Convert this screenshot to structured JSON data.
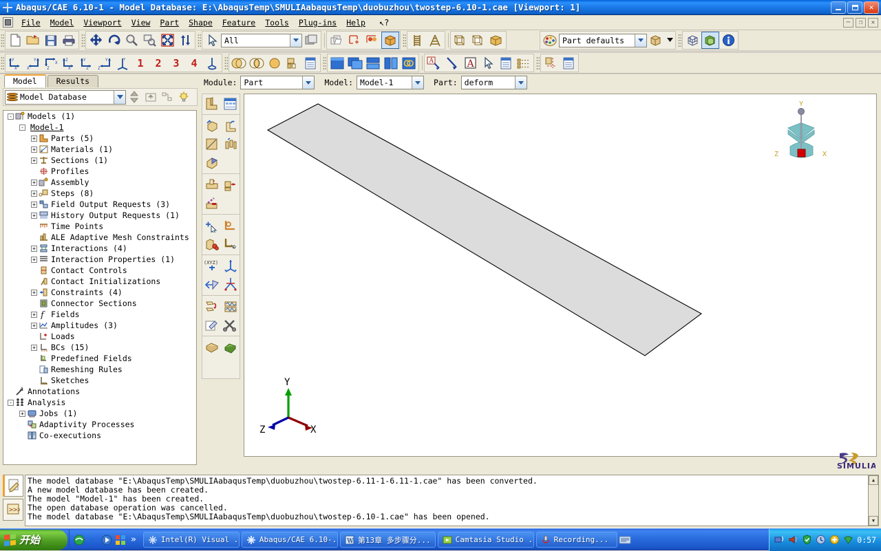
{
  "window": {
    "title": "Abaqus/CAE 6.10-1 - Model Database: E:\\AbaqusTemp\\SMULIAabaqusTemp\\duobuzhou\\twostep-6.10-1.cae [Viewport: 1]",
    "minimize": "_",
    "maximize": "❑",
    "close": "✕"
  },
  "menu": {
    "items": [
      {
        "label": "File"
      },
      {
        "label": "Model"
      },
      {
        "label": "Viewport"
      },
      {
        "label": "View"
      },
      {
        "label": "Part"
      },
      {
        "label": "Shape"
      },
      {
        "label": "Feature"
      },
      {
        "label": "Tools"
      },
      {
        "label": "Plug-ins"
      },
      {
        "label": "Help"
      }
    ],
    "help_arrow": "↖?",
    "win_restore": "─",
    "win_max": "❐",
    "win_close": "✕"
  },
  "toolbar1": {
    "selection_filter_value": "All",
    "render_style_value": "Part defaults",
    "buttons": [
      "new-file-icon",
      "open-file-icon",
      "save-icon",
      "print-icon",
      "pan-icon",
      "rotate-icon",
      "magnify-icon",
      "box-zoom-icon",
      "auto-fit-icon",
      "zoom-in-out-icon",
      "select-arrow-icon",
      "selection-filter-combo",
      "viewport-icon",
      "overlay-icon",
      "create-set-icon",
      "create-surface-icon",
      "display-group-icon",
      "mesh-seed-icon",
      "mesh-control-icon",
      "wireframe-icon",
      "hidden-line-icon",
      "shaded-icon",
      "color-palette-icon",
      "render-style-combo",
      "cube-icon",
      "more-arrow",
      "grid-cube-icon",
      "solid-cube-icon",
      "info-icon"
    ]
  },
  "toolbar2": {
    "view_buttons": [
      "view-yx-icon",
      "view-xy-icon",
      "view-zx-icon",
      "view-xz-icon",
      "view-yz-icon",
      "view-zy-icon",
      "iso-view-icon"
    ],
    "saved_views": [
      "1",
      "2",
      "3",
      "4"
    ],
    "apply_view_icon": "apply-view-icon",
    "more": [
      "union-icon",
      "intersect-icon",
      "circle-icon",
      "front-icon",
      "side-icon",
      "list-icon",
      "viewport-single-icon",
      "viewport-cascade-icon",
      "viewport-tile-horiz-icon",
      "viewport-tile-vert-icon",
      "link-viewport-icon",
      "annotation-text-icon",
      "annotation-arrow-icon",
      "text-tool-icon",
      "select-tool-icon",
      "manager-icon",
      "bullet-list-icon",
      "datum-icon",
      "table-icon"
    ]
  },
  "context": {
    "module_label": "Module:",
    "module_value": "Part",
    "model_label": "Model:",
    "model_value": "Model-1",
    "part_label": "Part:",
    "part_value": "deform"
  },
  "left_panel": {
    "tabs": [
      {
        "label": "Model",
        "active": true
      },
      {
        "label": "Results",
        "active": false
      }
    ],
    "database_combo": "Model Database",
    "toolbar_icons": [
      "sort-updown-icon",
      "parent-folder-icon",
      "filter-tree-icon",
      "tips-bulb-icon"
    ],
    "tree": [
      {
        "label": "Models (1)",
        "indent": 0,
        "expander": "-",
        "icon": "models-icon",
        "underline": false
      },
      {
        "label": "Model-1",
        "indent": 1,
        "expander": "-",
        "icon": "none",
        "underline": true
      },
      {
        "label": "Parts (5)",
        "indent": 2,
        "expander": "+",
        "icon": "parts-icon",
        "underline": false
      },
      {
        "label": "Materials (1)",
        "indent": 2,
        "expander": "+",
        "icon": "materials-icon",
        "underline": false
      },
      {
        "label": "Sections (1)",
        "indent": 2,
        "expander": "+",
        "icon": "sections-icon",
        "underline": false
      },
      {
        "label": "Profiles",
        "indent": 2,
        "expander": "",
        "icon": "profiles-icon",
        "underline": false
      },
      {
        "label": "Assembly",
        "indent": 2,
        "expander": "+",
        "icon": "assembly-icon",
        "underline": false
      },
      {
        "label": "Steps (8)",
        "indent": 2,
        "expander": "+",
        "icon": "steps-icon",
        "underline": false
      },
      {
        "label": "Field Output Requests (3)",
        "indent": 2,
        "expander": "+",
        "icon": "field-output-icon",
        "underline": false
      },
      {
        "label": "History Output Requests (1)",
        "indent": 2,
        "expander": "+",
        "icon": "history-output-icon",
        "underline": false
      },
      {
        "label": "Time Points",
        "indent": 2,
        "expander": "",
        "icon": "time-points-icon",
        "underline": false
      },
      {
        "label": "ALE Adaptive Mesh Constraints",
        "indent": 2,
        "expander": "",
        "icon": "ale-mesh-icon",
        "underline": false
      },
      {
        "label": "Interactions (4)",
        "indent": 2,
        "expander": "+",
        "icon": "interactions-icon",
        "underline": false
      },
      {
        "label": "Interaction Properties (1)",
        "indent": 2,
        "expander": "+",
        "icon": "interaction-prop-icon",
        "underline": false
      },
      {
        "label": "Contact Controls",
        "indent": 2,
        "expander": "",
        "icon": "contact-controls-icon",
        "underline": false
      },
      {
        "label": "Contact Initializations",
        "indent": 2,
        "expander": "",
        "icon": "contact-init-icon",
        "underline": false
      },
      {
        "label": "Constraints (4)",
        "indent": 2,
        "expander": "+",
        "icon": "constraints-icon",
        "underline": false
      },
      {
        "label": "Connector Sections",
        "indent": 2,
        "expander": "",
        "icon": "connector-icon",
        "underline": false
      },
      {
        "label": "Fields",
        "indent": 2,
        "expander": "+",
        "icon": "fields-icon",
        "underline": false
      },
      {
        "label": "Amplitudes (3)",
        "indent": 2,
        "expander": "+",
        "icon": "amplitudes-icon",
        "underline": false
      },
      {
        "label": "Loads",
        "indent": 2,
        "expander": "",
        "icon": "loads-icon",
        "underline": false
      },
      {
        "label": "BCs (15)",
        "indent": 2,
        "expander": "+",
        "icon": "bcs-icon",
        "underline": false
      },
      {
        "label": "Predefined Fields",
        "indent": 2,
        "expander": "",
        "icon": "predefined-icon",
        "underline": false
      },
      {
        "label": "Remeshing Rules",
        "indent": 2,
        "expander": "",
        "icon": "remeshing-icon",
        "underline": false
      },
      {
        "label": "Sketches",
        "indent": 2,
        "expander": "",
        "icon": "sketches-icon",
        "underline": false
      },
      {
        "label": "Annotations",
        "indent": 0,
        "expander": "",
        "icon": "annotations-icon",
        "underline": false
      },
      {
        "label": "Analysis",
        "indent": 0,
        "expander": "-",
        "icon": "analysis-icon",
        "underline": false
      },
      {
        "label": "Jobs (1)",
        "indent": 1,
        "expander": "+",
        "icon": "jobs-icon",
        "underline": false
      },
      {
        "label": "Adaptivity Processes",
        "indent": 1,
        "expander": "",
        "icon": "adaptivity-icon",
        "underline": false
      },
      {
        "label": "Co-executions",
        "indent": 1,
        "expander": "",
        "icon": "coexec-icon",
        "underline": false
      }
    ]
  },
  "module_toolbar": {
    "icons": [
      "create-part-icon",
      "part-manager-icon",
      "create-solid-extrude-icon",
      "create-shell-extrude-icon",
      "create-planar-shell-icon",
      "create-wire-icon",
      "create-blend-icon",
      "create-cut-extrude-icon",
      "create-revolve-cut-icon",
      "create-round-icon",
      "create-datum-point-icon",
      "create-datum-axis-icon",
      "create-partition-icon",
      "partition-cell-icon",
      "create-datum-csys-icon",
      "create-datum-plane-icon",
      "datum-translate-icon",
      "datum-pattern-icon",
      "copy-part-icon",
      "merge-part-icon",
      "edit-feature-icon",
      "tools-icon",
      "query-part-icon",
      "assign-section-icon"
    ]
  },
  "viewport": {
    "triad_labels": {
      "x": "X",
      "y": "Y",
      "z": "Z"
    },
    "view_cube_labels": {
      "x": "X",
      "y": "Y",
      "z": "Z"
    },
    "logo": "SIMULIA",
    "part_shape": "parallelogram-plate",
    "part_fill_color": "#dcdcdc",
    "part_edge_color": "#000000"
  },
  "messages": {
    "tabs": [
      "message-area-icon",
      "command-line-icon"
    ],
    "lines": [
      "The model database \"E:\\AbaqusTemp\\SMULIAabaqusTemp\\duobuzhou\\twostep-6.11-1-6.11-1.cae\" has been converted.",
      "A new model database has been created.",
      "The model \"Model-1\" has been created.",
      "The open database operation was cancelled.",
      "The model database \"E:\\AbaqusTemp\\SMULIAabaqusTemp\\duobuzhou\\twostep-6.10-1.cae\" has been opened."
    ],
    "scroll_up": "▲",
    "scroll_down": "▼"
  },
  "taskbar": {
    "start_label": "开始",
    "quicklaunch": [
      "browser-icon",
      "ie-icon",
      "media-icon",
      "showdesktop-icon"
    ],
    "overflow": "»",
    "tasks": [
      {
        "label": "Intel(R) Visual ...",
        "icon": "intel-icon"
      },
      {
        "label": "Abaqus/CAE 6.10-...",
        "icon": "abaqus-icon"
      },
      {
        "label": "第13章 多步骤分...",
        "icon": "word-icon"
      },
      {
        "label": "Camtasia Studio ...",
        "icon": "camtasia-icon"
      },
      {
        "label": "Recording...",
        "icon": "recording-icon"
      }
    ],
    "tray_icons": [
      "network-icon",
      "speaker-icon",
      "shield-icon",
      "clock-small-icon",
      "update-icon",
      "wifi-icon"
    ],
    "clock": "0:57",
    "lang_icon": "ime-icon"
  },
  "colors": {
    "title_blue": "#1b7ae8",
    "face": "#ece9d8",
    "accent_orange": "#f0a030",
    "viewport_bg": "#ffffff",
    "taskbar_blue": "#2b6ee0",
    "start_green": "#4f9c22"
  }
}
